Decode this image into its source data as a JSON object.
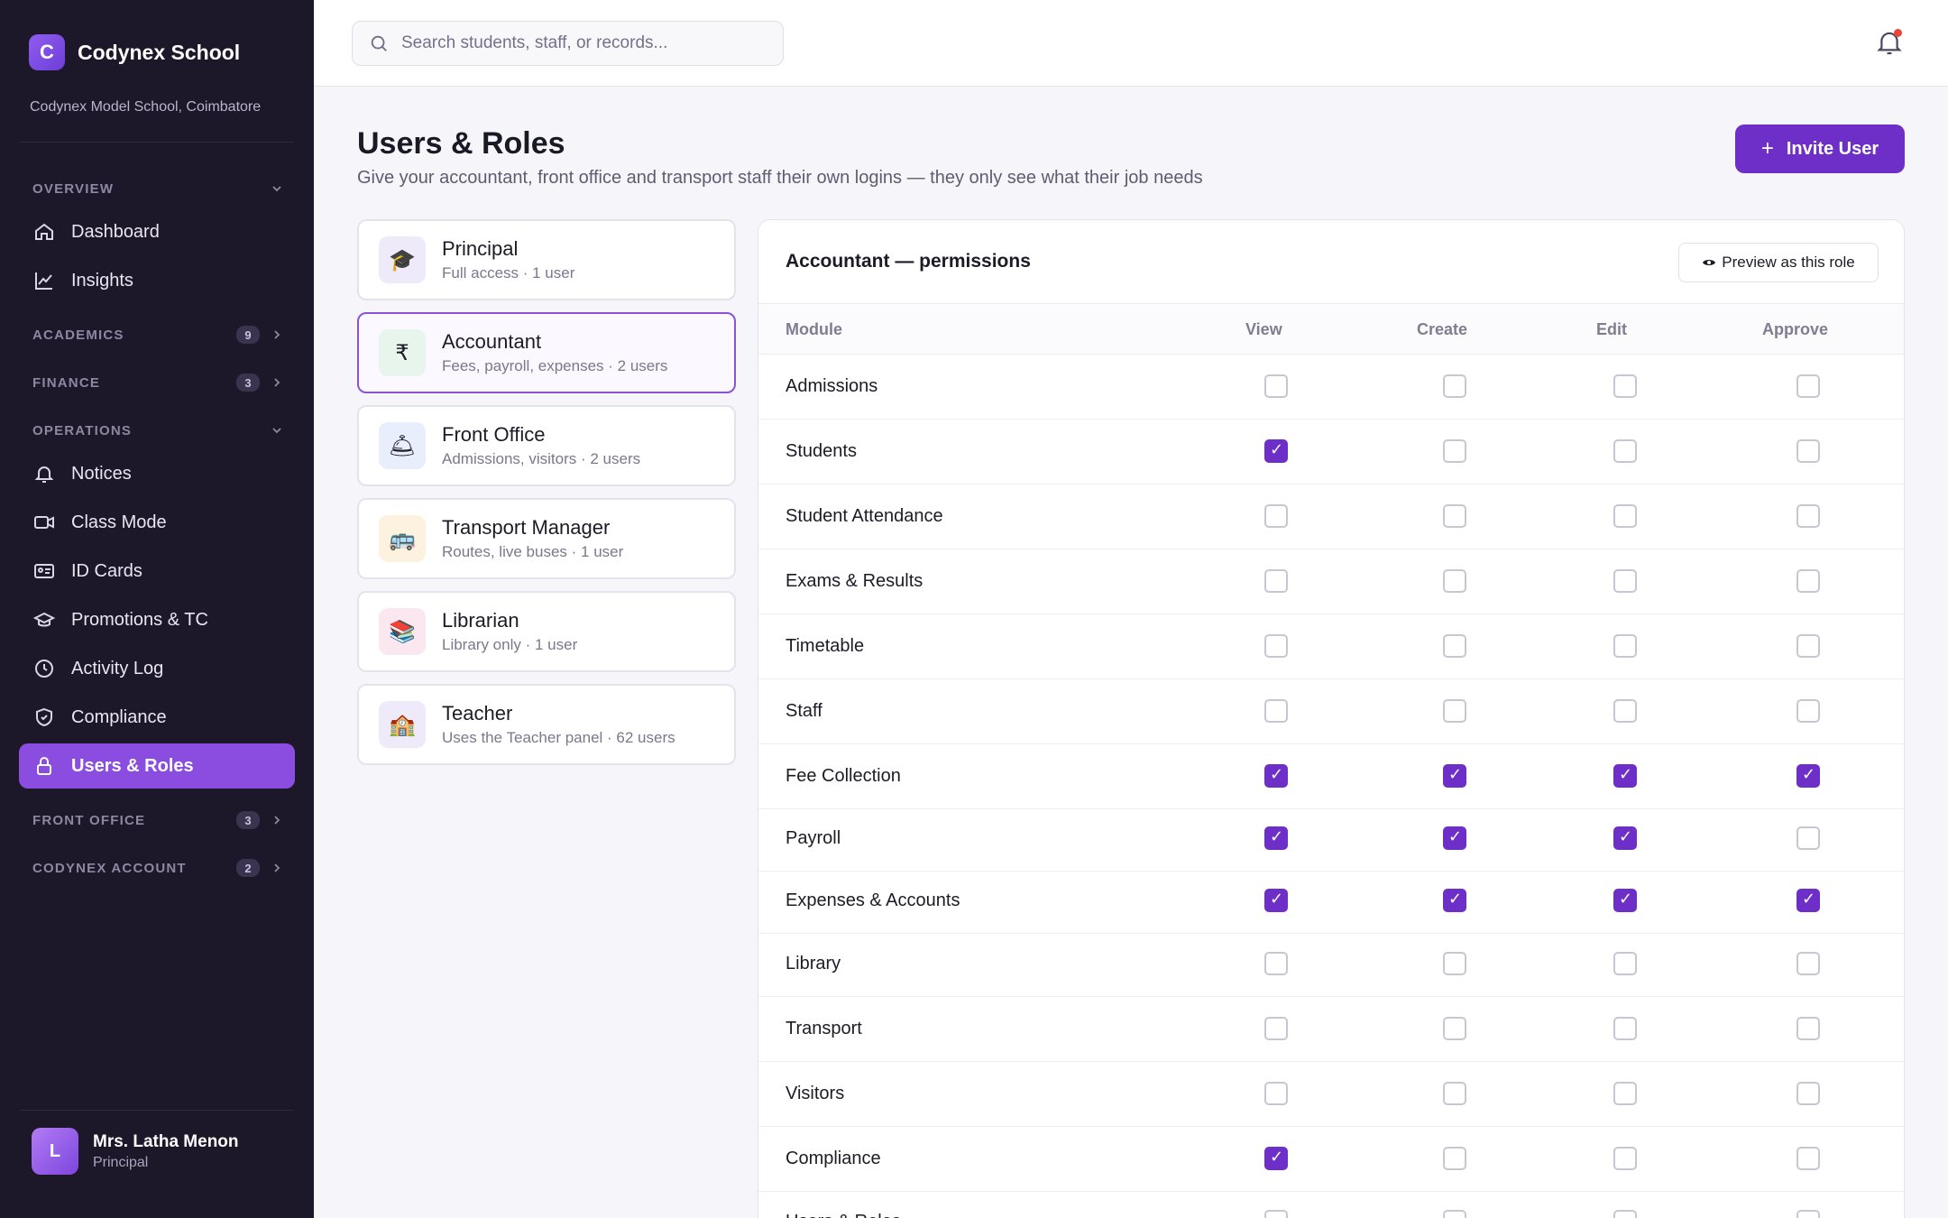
{
  "brand": {
    "name": "Codynex School",
    "logo_letter": "C",
    "school": "Codynex Model School, Coimbatore"
  },
  "sidebar": {
    "sections": {
      "overview": {
        "label": "OVERVIEW"
      },
      "academics": {
        "label": "ACADEMICS",
        "count": "9"
      },
      "finance": {
        "label": "FINANCE",
        "count": "3"
      },
      "operations": {
        "label": "OPERATIONS"
      },
      "front_office": {
        "label": "FRONT OFFICE",
        "count": "3"
      },
      "codynex_account": {
        "label": "CODYNEX ACCOUNT",
        "count": "2"
      }
    },
    "items": [
      {
        "label": "Dashboard",
        "icon": "home-icon"
      },
      {
        "label": "Insights",
        "icon": "chart-line-icon"
      },
      {
        "label": "Notices",
        "icon": "bell-icon"
      },
      {
        "label": "Class Mode",
        "icon": "video-icon"
      },
      {
        "label": "ID Cards",
        "icon": "id-card-icon"
      },
      {
        "label": "Promotions & TC",
        "icon": "graduation-cap-icon"
      },
      {
        "label": "Activity Log",
        "icon": "clock-icon"
      },
      {
        "label": "Compliance",
        "icon": "shield-icon"
      },
      {
        "label": "Users & Roles",
        "icon": "lock-icon",
        "active": true
      }
    ],
    "user": {
      "initial": "L",
      "name": "Mrs. Latha Menon",
      "role": "Principal"
    }
  },
  "topbar": {
    "search_placeholder": "Search students, staff, or records..."
  },
  "header": {
    "title": "Users & Roles",
    "subtitle": "Give your accountant, front office and transport staff their own logins — they only see what their job needs",
    "invite_label": "Invite User"
  },
  "roles": [
    {
      "name": "Principal",
      "desc": "Full access · 1 user",
      "emoji": "🎓",
      "bg": "#efeaf9"
    },
    {
      "name": "Accountant",
      "desc": "Fees, payroll, expenses · 2 users",
      "emoji": "₹",
      "bg": "#e7f5ec",
      "selected": true
    },
    {
      "name": "Front Office",
      "desc": "Admissions, visitors · 2 users",
      "emoji": "🛎",
      "bg": "#e8eefb"
    },
    {
      "name": "Transport Manager",
      "desc": "Routes, live buses · 1 user",
      "emoji": "🚌",
      "bg": "#fdf1df"
    },
    {
      "name": "Librarian",
      "desc": "Library only · 1 user",
      "emoji": "📚",
      "bg": "#fbe7ef"
    },
    {
      "name": "Teacher",
      "desc": "Uses the Teacher panel · 62 users",
      "emoji": "🏫",
      "bg": "#efeaf9"
    }
  ],
  "permissions": {
    "title": "Accountant — permissions",
    "preview_label": "Preview as this role",
    "columns": [
      "Module",
      "View",
      "Create",
      "Edit",
      "Approve"
    ],
    "rows": [
      {
        "module": "Admissions",
        "perms": [
          false,
          false,
          false,
          false
        ]
      },
      {
        "module": "Students",
        "perms": [
          true,
          false,
          false,
          false
        ]
      },
      {
        "module": "Student Attendance",
        "perms": [
          false,
          false,
          false,
          false
        ]
      },
      {
        "module": "Exams & Results",
        "perms": [
          false,
          false,
          false,
          false
        ]
      },
      {
        "module": "Timetable",
        "perms": [
          false,
          false,
          false,
          false
        ]
      },
      {
        "module": "Staff",
        "perms": [
          false,
          false,
          false,
          false
        ]
      },
      {
        "module": "Fee Collection",
        "perms": [
          true,
          true,
          true,
          true
        ]
      },
      {
        "module": "Payroll",
        "perms": [
          true,
          true,
          true,
          false
        ]
      },
      {
        "module": "Expenses & Accounts",
        "perms": [
          true,
          true,
          true,
          true
        ]
      },
      {
        "module": "Library",
        "perms": [
          false,
          false,
          false,
          false
        ]
      },
      {
        "module": "Transport",
        "perms": [
          false,
          false,
          false,
          false
        ]
      },
      {
        "module": "Visitors",
        "perms": [
          false,
          false,
          false,
          false
        ]
      },
      {
        "module": "Compliance",
        "perms": [
          true,
          false,
          false,
          false
        ]
      },
      {
        "module": "Users & Roles",
        "perms": [
          false,
          false,
          false,
          false
        ]
      }
    ]
  },
  "colors": {
    "accent": "#6e2fc8",
    "sidebar_bg": "#1c1829",
    "active_nav": "#8a4de0"
  }
}
